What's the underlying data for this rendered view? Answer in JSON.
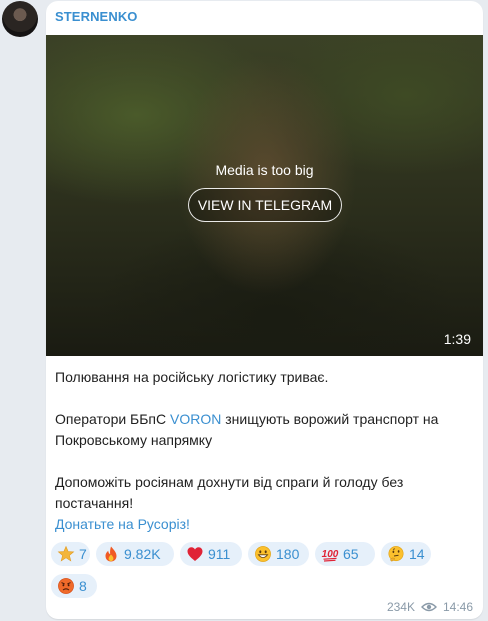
{
  "post": {
    "author": "STERNENKO",
    "media": {
      "note": "Media is too big",
      "button_label": "VIEW IN TELEGRAM",
      "duration": "1:39"
    },
    "text": {
      "line1": "Полювання на російську логістику триває.",
      "line2_before": "Оператори ББпС ",
      "line2_link": "VORON",
      "line2_after": " знищують ворожий транспорт на Покровському напрямку",
      "line3": "Допоможіть росіянам дохнути від спраги й голоду без постачання!",
      "line4_link": "Донатьте на Русоріз!"
    },
    "reactions": [
      {
        "icon": "star-icon",
        "count": "7"
      },
      {
        "icon": "fire-icon",
        "count": "9.82K"
      },
      {
        "icon": "heart-icon",
        "count": "911"
      },
      {
        "icon": "grinning-face-icon",
        "count": "180"
      },
      {
        "icon": "hundred-points-icon",
        "count": "65"
      },
      {
        "icon": "thinking-face-icon",
        "count": "14"
      },
      {
        "icon": "angry-face-icon",
        "count": "8"
      }
    ],
    "views": "234K",
    "time": "14:46"
  },
  "colors": {
    "accent": "#3a8fd0",
    "chip_bg": "#e6f0fa",
    "chat_bg": "#e7ebf0"
  }
}
